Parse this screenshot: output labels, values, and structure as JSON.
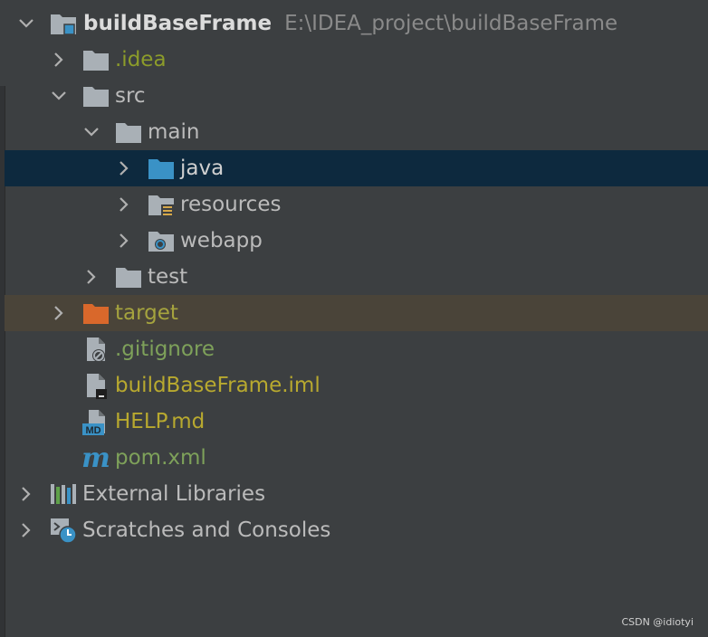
{
  "project": {
    "name": "buildBaseFrame",
    "path": "E:\\IDEA_project\\buildBaseFrame"
  },
  "tree": {
    "idea": ".idea",
    "src": "src",
    "main": "main",
    "java": "java",
    "resources": "resources",
    "webapp": "webapp",
    "test": "test",
    "target": "target",
    "gitignore": ".gitignore",
    "iml": "buildBaseFrame.iml",
    "help": "HELP.md",
    "pom": "pom.xml",
    "external": "External Libraries",
    "scratches": "Scratches and Consoles"
  },
  "icons": {
    "md_badge": "MD",
    "maven_badge": "m"
  },
  "watermark": "CSDN @idiotyi",
  "colors": {
    "background": "#3c3f41",
    "selected_row": "#0d293e",
    "excluded_row": "#4a4439",
    "folder": "#a9b0b6",
    "source_folder": "#3a92c6",
    "excluded_folder": "#d9682b"
  }
}
